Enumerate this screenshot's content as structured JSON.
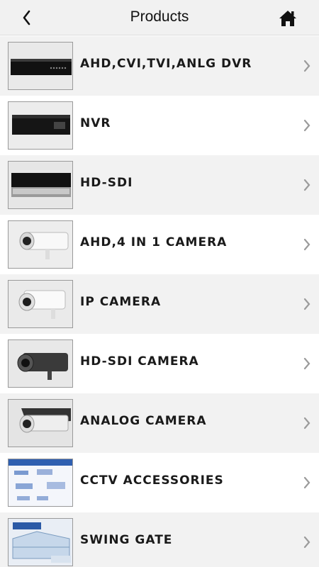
{
  "header": {
    "title": "Products",
    "back_icon": "chevron-left-icon",
    "home_icon": "home-icon"
  },
  "products": [
    {
      "label": "AHD,CVI,TVI,ANLG DVR",
      "thumb": "dvr"
    },
    {
      "label": "NVR",
      "thumb": "nvr"
    },
    {
      "label": "HD-SDI",
      "thumb": "hdsdi"
    },
    {
      "label": "AHD,4 IN 1 CAMERA",
      "thumb": "bullet-white"
    },
    {
      "label": "IP CAMERA",
      "thumb": "bullet-white2"
    },
    {
      "label": "HD-SDI CAMERA",
      "thumb": "bullet-dark"
    },
    {
      "label": "ANALOG CAMERA",
      "thumb": "bullet-box"
    },
    {
      "label": "CCTV ACCESSORIES",
      "thumb": "accessories"
    },
    {
      "label": "SWING GATE",
      "thumb": "swing-gate"
    }
  ],
  "row_icon": "chevron-right-icon",
  "colors": {
    "header_bg": "#f1f1f1",
    "row_shade": "#f2f2f2",
    "row_white": "#ffffff",
    "chevron": "#9b9b9b"
  }
}
